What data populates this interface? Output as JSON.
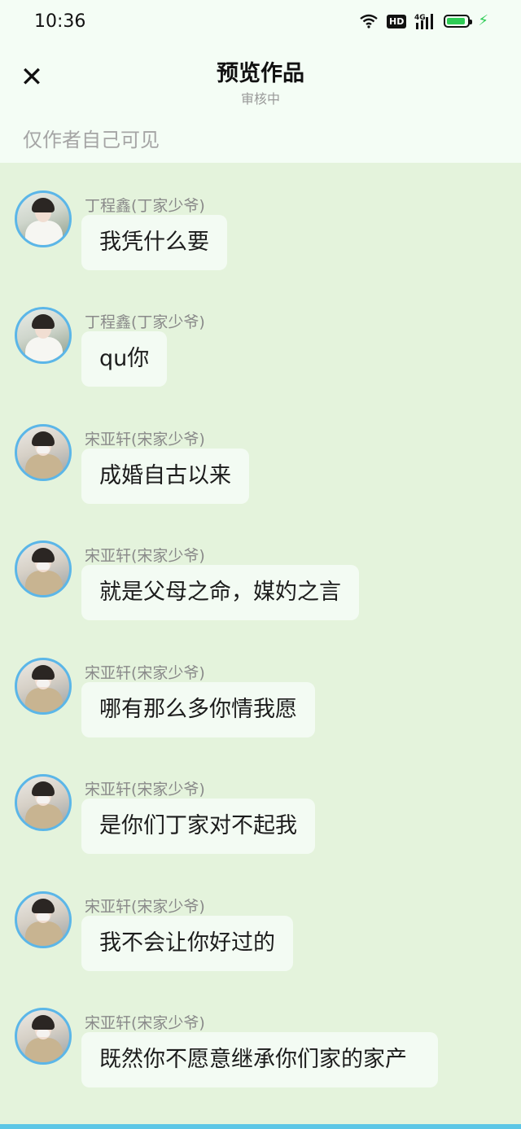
{
  "status_bar": {
    "time": "10:36",
    "hd": "HD",
    "network": "4G",
    "battery_level": 0.9,
    "accent_green": "#2ecc55"
  },
  "header": {
    "close_icon": "close-icon",
    "title": "预览作品",
    "subtitle": "审核中",
    "visibility_note": "仅作者自己可见"
  },
  "messages": [
    {
      "name": "丁程鑫(丁家少爷)",
      "text": "我凭什么要",
      "avatar": "avatar-ding"
    },
    {
      "name": "丁程鑫(丁家少爷)",
      "text": "qu你",
      "avatar": "avatar-ding"
    },
    {
      "name": "宋亚轩(宋家少爷)",
      "text": "成婚自古以来",
      "avatar": "avatar-song"
    },
    {
      "name": "宋亚轩(宋家少爷)",
      "text": "就是父母之命，媒妁之言",
      "avatar": "avatar-song"
    },
    {
      "name": "宋亚轩(宋家少爷)",
      "text": "哪有那么多你情我愿",
      "avatar": "avatar-song"
    },
    {
      "name": "宋亚轩(宋家少爷)",
      "text": "是你们丁家对不起我",
      "avatar": "avatar-song"
    },
    {
      "name": "宋亚轩(宋家少爷)",
      "text": "我不会让你好过的",
      "avatar": "avatar-song"
    },
    {
      "name": "宋亚轩(宋家少爷)",
      "text": "既然你不愿意继承你们家的家产",
      "avatar": "avatar-song"
    }
  ],
  "colors": {
    "background": "#e4f3dc",
    "header_background": "#f4fdf5",
    "bubble": "#f3fbf3",
    "avatar_border": "#5bb6e8"
  }
}
